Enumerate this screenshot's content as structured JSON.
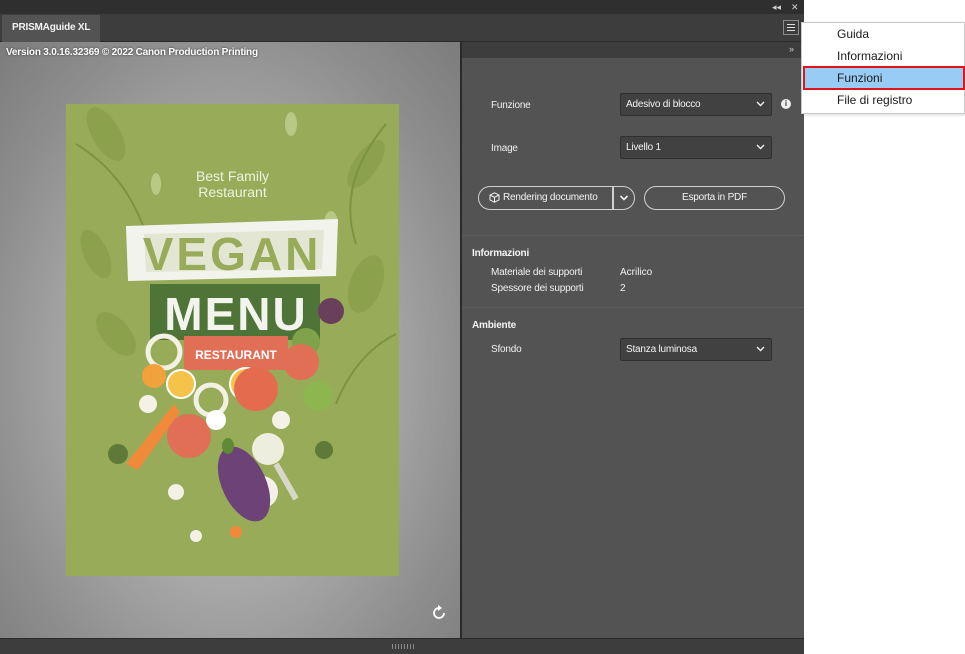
{
  "window": {
    "tab_title": "PRISMAguide XL",
    "controls": {
      "collapse": "◂◂",
      "close": "✕"
    }
  },
  "preview": {
    "version_text": "Version 3.0.16.32369 © 2022 Canon Production Printing",
    "poster": {
      "subtitle_line1": "Best Family",
      "subtitle_line2": "Restaurant",
      "word1": "VEGAN",
      "word2": "MENU",
      "ribbon": "RESTAURANT"
    }
  },
  "properties": {
    "collapse_icon": "»",
    "funzione": {
      "label": "Funzione",
      "value": "Adesivo di blocco"
    },
    "image": {
      "label": "Image",
      "value": "Livello 1"
    },
    "render_button": "Rendering documento",
    "export_button": "Esporta in PDF",
    "info_section": {
      "title": "Informazioni",
      "rows": [
        {
          "label": "Materiale dei supporti",
          "value": "Acrilico"
        },
        {
          "label": "Spessore dei supporti",
          "value": "2"
        }
      ]
    },
    "ambiente_section": {
      "title": "Ambiente",
      "sfondo": {
        "label": "Sfondo",
        "value": "Stanza luminosa"
      }
    }
  },
  "menu": {
    "items": [
      {
        "label": "Guida"
      },
      {
        "label": "Informazioni"
      },
      {
        "label": "Funzioni",
        "selected": true
      },
      {
        "label": "File di registro"
      }
    ]
  },
  "colors": {
    "panel": "#535353",
    "poster_green": "#98ab59",
    "menu_highlight": "#99ccf5",
    "highlight_border": "#e0151c"
  }
}
